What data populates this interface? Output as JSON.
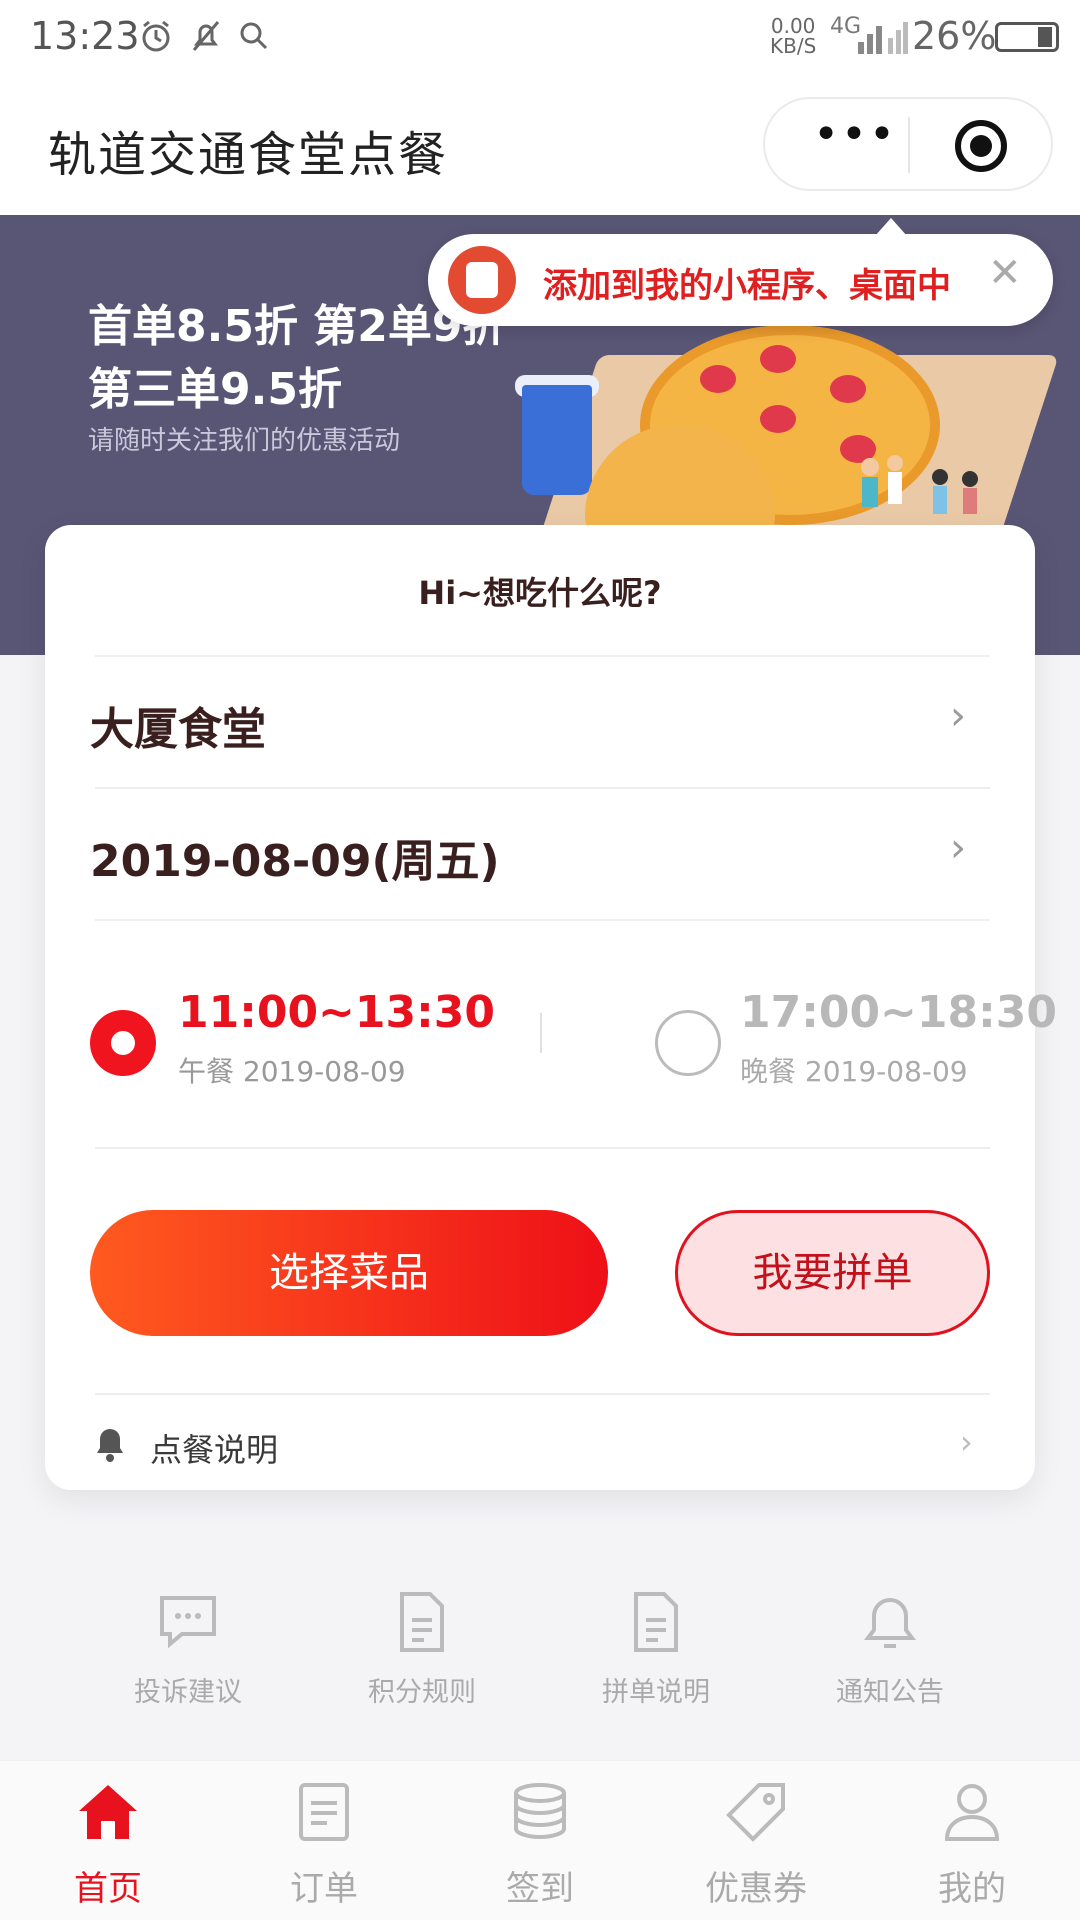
{
  "status_bar": {
    "time": "13:23",
    "net_speed_top": "0.00",
    "net_speed_bottom": "KB/S",
    "network": "4G",
    "battery": "26%"
  },
  "nav": {
    "title": "轨道交通食堂点餐",
    "more_label": "•••"
  },
  "banner": {
    "line1": "首单8.5折 第2单9折",
    "line2": "第三单9.5折",
    "line3": "请随时关注我们的优惠活动"
  },
  "tooltip": {
    "text": "添加到我的小程序、桌面中",
    "close": "✕"
  },
  "card": {
    "greeting": "Hi~想吃什么呢?",
    "canteen": "大厦食堂",
    "date": "2019-08-09(周五)",
    "chevron": "›",
    "slots": [
      {
        "time": "11:00~13:30",
        "sub": "午餐 2019-08-09",
        "selected": true
      },
      {
        "time": "17:00~18:30",
        "sub": "晚餐 2019-08-09",
        "selected": false
      }
    ],
    "primary_button": "选择菜品",
    "secondary_button": "我要拼单",
    "notice": "点餐说明"
  },
  "quick_links": [
    {
      "label": "投诉建议",
      "icon": "chat-icon"
    },
    {
      "label": "积分规则",
      "icon": "document-icon"
    },
    {
      "label": "拼单说明",
      "icon": "document-icon"
    },
    {
      "label": "通知公告",
      "icon": "bell-icon"
    }
  ],
  "tabs": [
    {
      "label": "首页",
      "icon": "home-icon",
      "active": true
    },
    {
      "label": "订单",
      "icon": "order-icon",
      "active": false
    },
    {
      "label": "签到",
      "icon": "coins-icon",
      "active": false
    },
    {
      "label": "优惠券",
      "icon": "tag-icon",
      "active": false
    },
    {
      "label": "我的",
      "icon": "user-icon",
      "active": false
    }
  ],
  "colors": {
    "accent": "#e8121e",
    "banner_bg": "#595575",
    "page_bg": "#f4f4f7"
  }
}
